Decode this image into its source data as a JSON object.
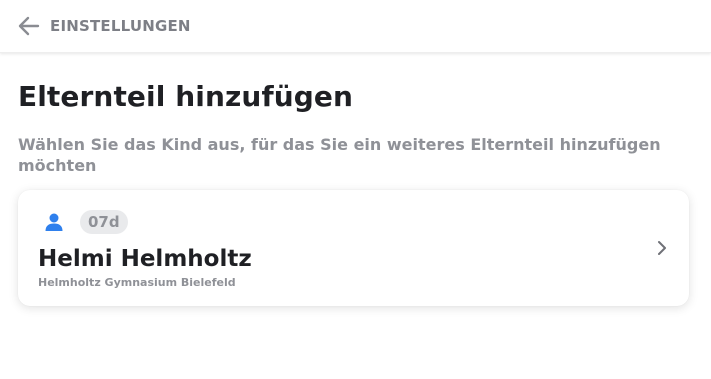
{
  "header": {
    "back_label": "EINSTELLUNGEN",
    "back_icon": "arrow-left-icon"
  },
  "page": {
    "title": "Elternteil hinzufügen",
    "subtitle": "Wählen Sie das Kind aus, für das Sie ein weiteres Elternteil hinzufügen möchten"
  },
  "children": [
    {
      "class_badge": "07d",
      "name": "Helmi Helmholtz",
      "school": "Helmholtz Gymnasium Bielefeld",
      "icon": "person-icon",
      "chevron_icon": "chevron-right-icon"
    }
  ],
  "colors": {
    "accent_blue": "#2f80ed",
    "muted_text": "#8f9197",
    "title_text": "#1f2024",
    "badge_bg": "#e9eaec"
  }
}
